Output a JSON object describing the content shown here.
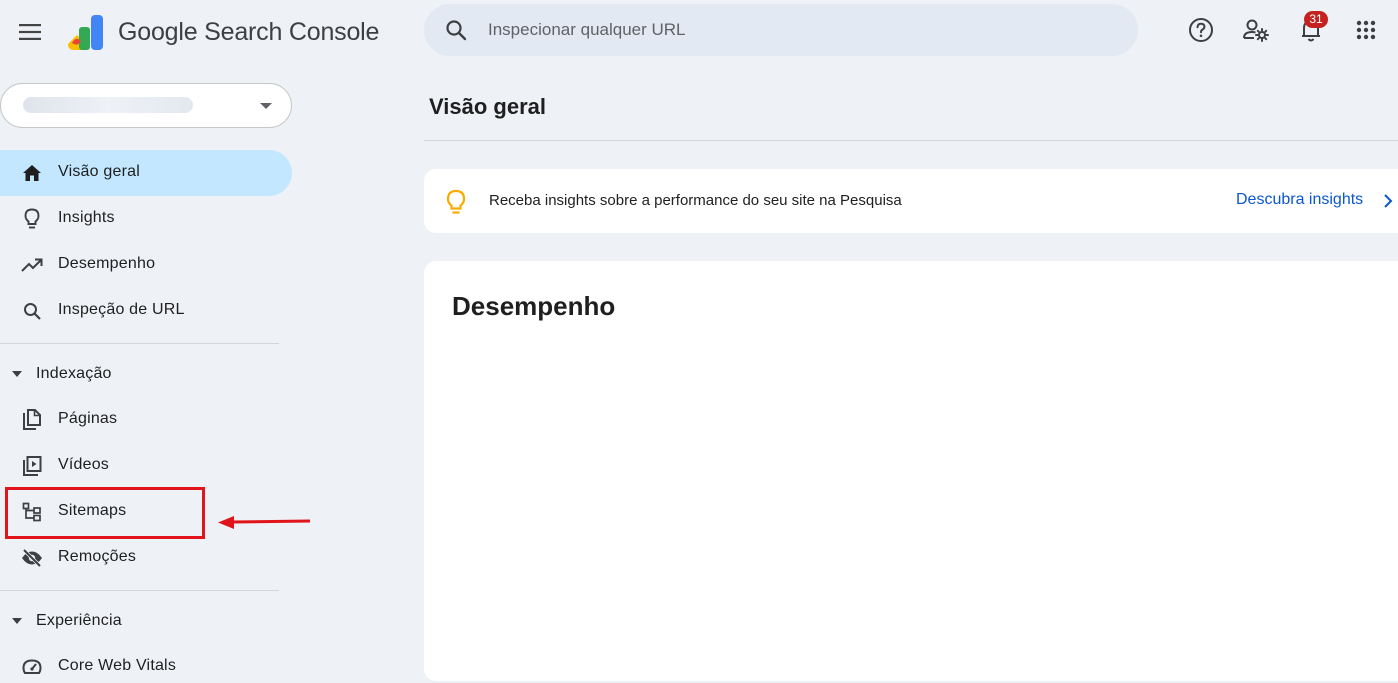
{
  "header": {
    "product_name": "Google Search Console",
    "search_placeholder": "Inspecionar qualquer URL",
    "notification_count": "31",
    "icons": [
      "menu-icon",
      "help-icon",
      "user-settings-icon",
      "notifications-icon",
      "apps-icon"
    ]
  },
  "property": {
    "selected_value": ""
  },
  "sidebar": {
    "items": [
      {
        "label": "Visão geral",
        "icon": "home-icon",
        "active": true
      },
      {
        "label": "Insights",
        "icon": "lightbulb-icon"
      },
      {
        "label": "Desempenho",
        "icon": "trending-up-icon"
      },
      {
        "label": "Inspeção de URL",
        "icon": "search-icon"
      }
    ],
    "sections": [
      {
        "label": "Indexação",
        "items": [
          {
            "label": "Páginas",
            "icon": "pages-icon"
          },
          {
            "label": "Vídeos",
            "icon": "video-icon"
          },
          {
            "label": "Sitemaps",
            "icon": "sitemap-icon"
          },
          {
            "label": "Remoções",
            "icon": "visibility-off-icon"
          }
        ]
      },
      {
        "label": "Experiência",
        "items": [
          {
            "label": "Core Web Vitals",
            "icon": "speed-icon"
          }
        ]
      }
    ]
  },
  "main": {
    "page_title": "Visão geral",
    "insight_banner": {
      "text": "Receba insights sobre a performance do seu site na Pesquisa",
      "link_label": "Descubra insights"
    },
    "performance_card": {
      "title": "Desempenho"
    }
  },
  "colors": {
    "background": "#eef1f6",
    "active_nav": "#c2e7ff",
    "link": "#0b57d0",
    "highlight_annotation": "#e0141a",
    "badge": "#c5221f"
  }
}
